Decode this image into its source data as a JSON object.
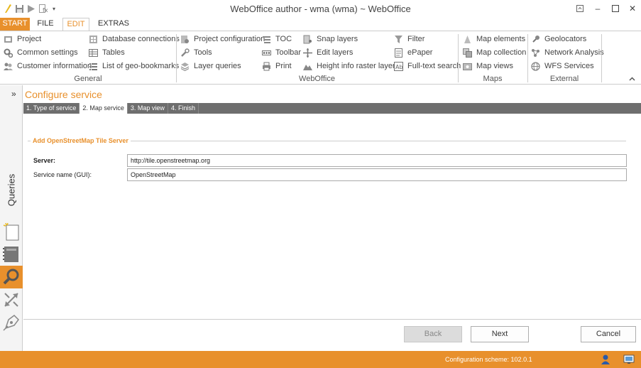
{
  "window": {
    "title": "WebOffice author - wma (wma) ~ WebOffice"
  },
  "menu_tabs": {
    "start": "START",
    "file": "FILE",
    "edit": "EDIT",
    "extras": "EXTRAS"
  },
  "ribbon": {
    "general": {
      "label": "General",
      "items": [
        "Project",
        "Common settings",
        "Customer information",
        "Database connections",
        "Tables",
        "List of geo-bookmarks"
      ]
    },
    "weboffice": {
      "label": "WebOffice",
      "items": [
        "Project configuration",
        "Tools",
        "Layer queries",
        "TOC",
        "Toolbar",
        "Print",
        "Snap layers",
        "Edit layers",
        "Height info raster layers",
        "Filter",
        "ePaper",
        "Full-text search"
      ]
    },
    "maps": {
      "label": "Maps",
      "items": [
        "Map elements",
        "Map collection",
        "Map views"
      ]
    },
    "external": {
      "label": "External",
      "items": [
        "Geolocators",
        "Network Analysis",
        "WFS Services"
      ]
    }
  },
  "sidebar": {
    "queries_label": "Queries",
    "expand_glyph": "»"
  },
  "wizard": {
    "title": "Configure service",
    "steps": [
      "1. Type of service",
      "2. Map service",
      "3. Map view",
      "4. Finish"
    ],
    "active_step": 1,
    "section_title": "Add OpenStreetMap Tile Server",
    "server_label": "Server:",
    "server_value": "http://tile.openstreetmap.org",
    "service_name_label": "Service name (GUI):",
    "service_name_value": "OpenStreetMap",
    "back_label": "Back",
    "next_label": "Next",
    "cancel_label": "Cancel"
  },
  "status": {
    "text": "Configuration scheme:  102.0.1"
  },
  "colors": {
    "accent": "#e8902c",
    "step_bar": "#6e6e6e"
  }
}
